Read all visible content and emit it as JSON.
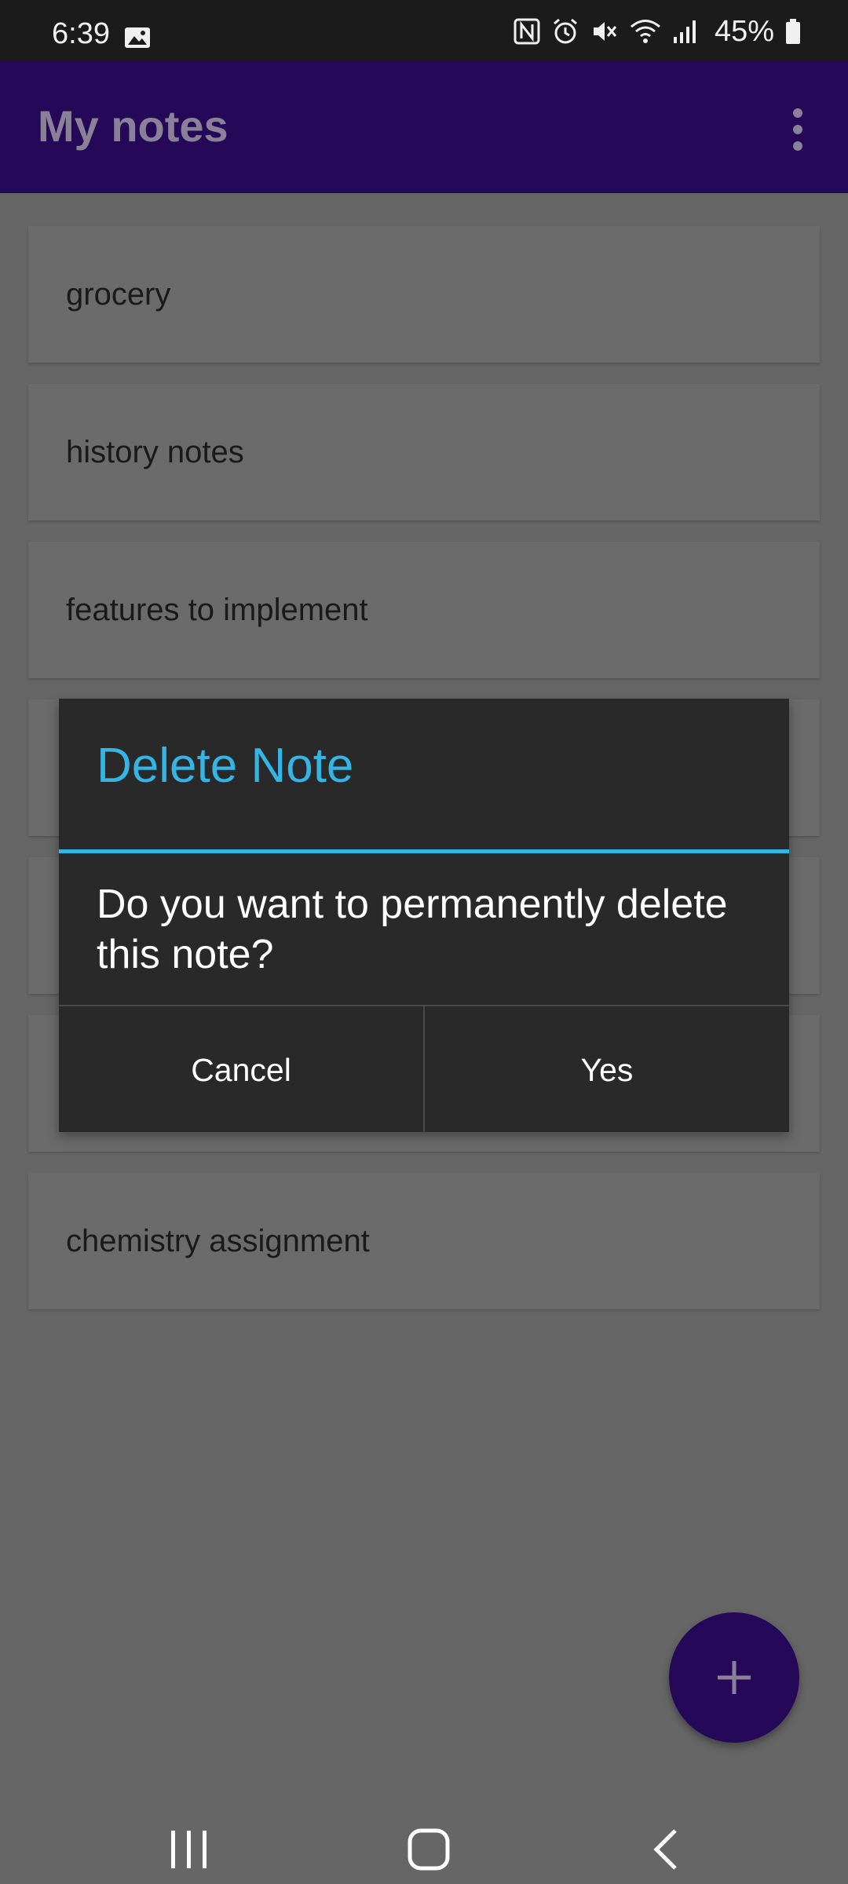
{
  "status_bar": {
    "time": "6:39",
    "battery": "45%",
    "icons": [
      "gallery-icon",
      "nfc-icon",
      "alarm-icon",
      "mute-icon",
      "wifi-icon",
      "signal-icon",
      "battery-icon"
    ]
  },
  "app_bar": {
    "title": "My notes",
    "overflow_icon": "more-vertical-icon"
  },
  "notes": [
    {
      "title": "grocery"
    },
    {
      "title": "history notes"
    },
    {
      "title": "features to implement"
    },
    {
      "title": ""
    },
    {
      "title": ""
    },
    {
      "title": ""
    },
    {
      "title": "chemistry assignment"
    }
  ],
  "dialog": {
    "title": "Delete Note",
    "message": "Do you want to permanently delete this note?",
    "cancel_label": "Cancel",
    "confirm_label": "Yes"
  },
  "fab": {
    "icon": "plus-icon"
  },
  "nav_bar": {
    "recents_icon": "recents-icon",
    "home_icon": "home-icon",
    "back_icon": "back-icon"
  },
  "colors": {
    "app_bar": "#260859",
    "dialog_accent": "#33b5e5",
    "dialog_background": "#292929",
    "scrim": "#666666"
  }
}
